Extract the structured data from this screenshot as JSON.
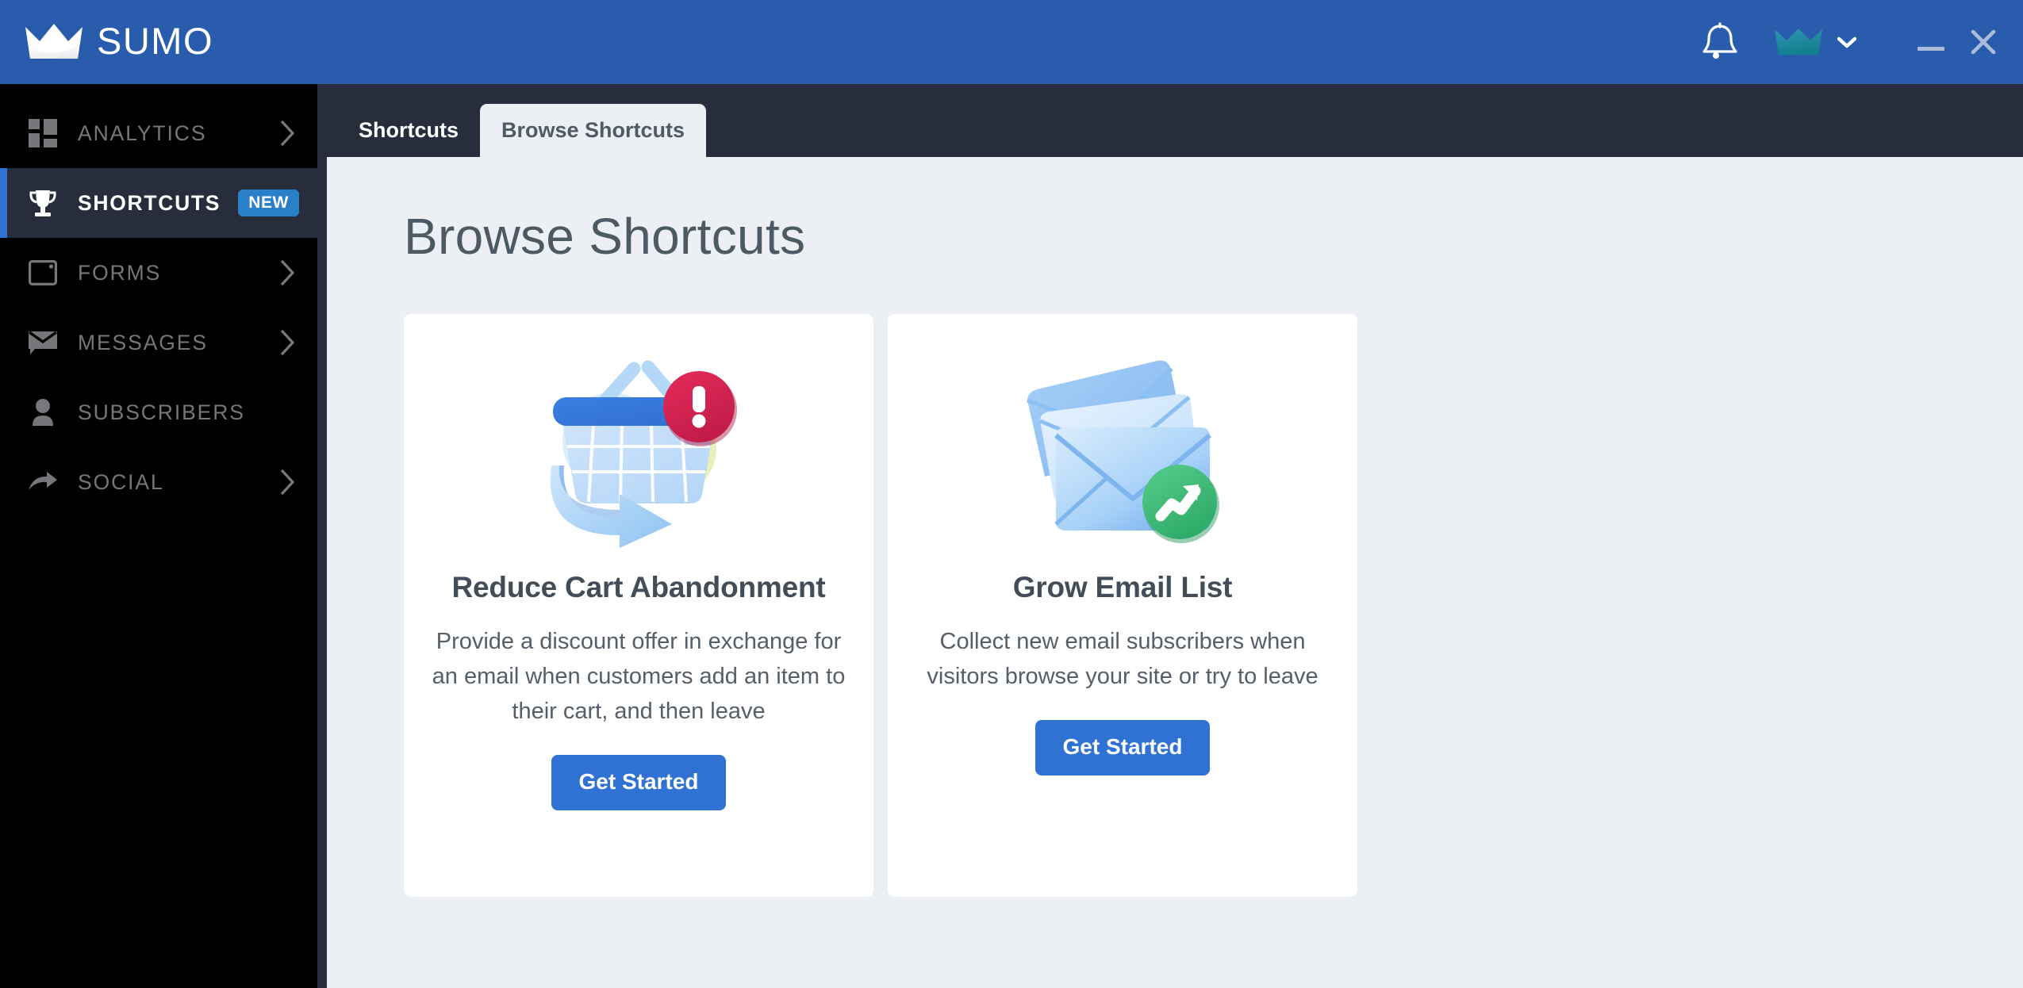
{
  "header": {
    "brand_name": "SUMO",
    "logo_icon": "crown-icon",
    "notifications_icon": "bell-icon",
    "avatar_icon": "crown-avatar-icon",
    "account_chevron_icon": "chevron-down-icon",
    "minimize_label": "—",
    "close_label": "✕",
    "brand_color": "#2a5cad"
  },
  "sidebar": {
    "background_color": "#000000",
    "active_accent_color": "#3072d4",
    "active_background_color": "#282d3d",
    "items": [
      {
        "label": "ANALYTICS",
        "icon": "grid-dashboard-icon",
        "has_chevron": true,
        "active": false,
        "badge": null
      },
      {
        "label": "SHORTCUTS",
        "icon": "trophy-icon",
        "has_chevron": false,
        "active": true,
        "badge": "NEW"
      },
      {
        "label": "FORMS",
        "icon": "window-icon",
        "has_chevron": true,
        "active": false,
        "badge": null
      },
      {
        "label": "MESSAGES",
        "icon": "envelope-icon",
        "has_chevron": true,
        "active": false,
        "badge": null
      },
      {
        "label": "SUBSCRIBERS",
        "icon": "person-icon",
        "has_chevron": false,
        "active": false,
        "badge": null
      },
      {
        "label": "SOCIAL",
        "icon": "share-arrow-icon",
        "has_chevron": true,
        "active": false,
        "badge": null
      }
    ]
  },
  "tabs": [
    {
      "label": "Shortcuts",
      "active": false
    },
    {
      "label": "Browse Shortcuts",
      "active": true
    }
  ],
  "main": {
    "page_title": "Browse Shortcuts",
    "cards": [
      {
        "illustration": "shopping-basket-alert-illustration",
        "title": "Reduce Cart Abandonment",
        "description": "Provide a discount offer in exchange for an email when customers add an item to their cart, and then leave",
        "button_label": "Get Started",
        "button_color": "#3072d4"
      },
      {
        "illustration": "envelope-stack-growth-illustration",
        "title": "Grow Email List",
        "description": "Collect new email subscribers when visitors browse your site or try to leave",
        "button_label": "Get Started",
        "button_color": "#3072d4"
      }
    ]
  }
}
